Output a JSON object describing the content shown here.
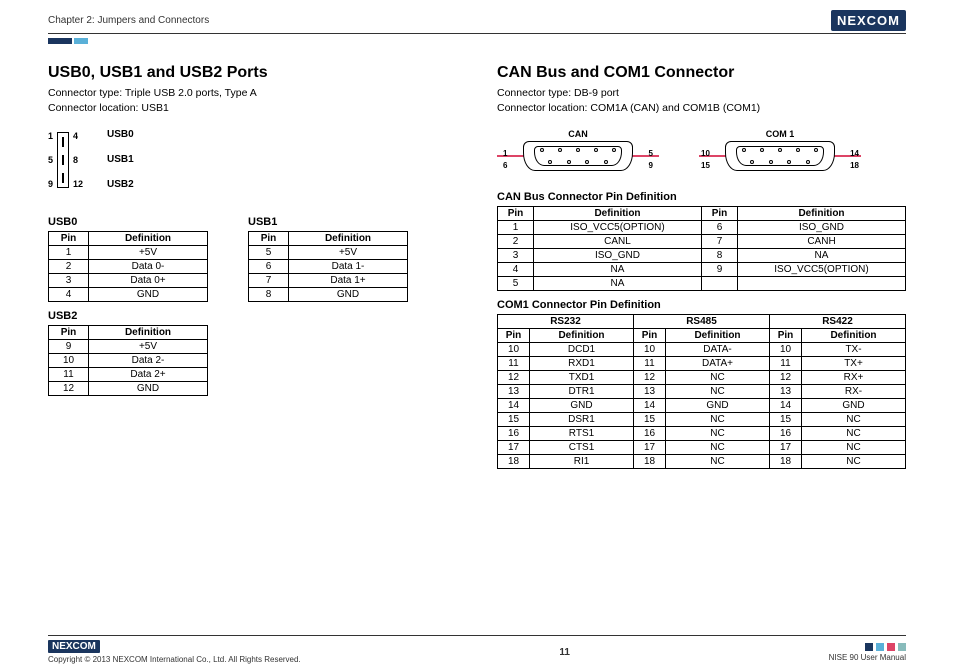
{
  "header": {
    "chapter": "Chapter 2: Jumpers and Connectors",
    "logo": "NEXCOM"
  },
  "left": {
    "title": "USB0, USB1 and USB2 Ports",
    "connector_type": "Connector type: Triple USB 2.0 ports, Type A",
    "connector_location": "Connector location: USB1",
    "diagram": {
      "rows": [
        {
          "pinL": "1",
          "pinR": "4",
          "label": "USB0"
        },
        {
          "pinL": "5",
          "pinR": "8",
          "label": "USB1"
        },
        {
          "pinL": "9",
          "pinR": "12",
          "label": "USB2"
        }
      ]
    },
    "tables": {
      "usb0": {
        "title": "USB0",
        "headers": [
          "Pin",
          "Definition"
        ],
        "rows": [
          [
            "1",
            "+5V"
          ],
          [
            "2",
            "Data 0-"
          ],
          [
            "3",
            "Data 0+"
          ],
          [
            "4",
            "GND"
          ]
        ]
      },
      "usb1": {
        "title": "USB1",
        "headers": [
          "Pin",
          "Definition"
        ],
        "rows": [
          [
            "5",
            "+5V"
          ],
          [
            "6",
            "Data 1-"
          ],
          [
            "7",
            "Data 1+"
          ],
          [
            "8",
            "GND"
          ]
        ]
      },
      "usb2": {
        "title": "USB2",
        "headers": [
          "Pin",
          "Definition"
        ],
        "rows": [
          [
            "9",
            "+5V"
          ],
          [
            "10",
            "Data 2-"
          ],
          [
            "11",
            "Data 2+"
          ],
          [
            "12",
            "GND"
          ]
        ]
      }
    }
  },
  "right": {
    "title": "CAN Bus and COM1 Connector",
    "connector_type": "Connector type: DB-9 port",
    "connector_location": "Connector location: COM1A (CAN) and COM1B (COM1)",
    "diagram": {
      "left": {
        "label": "CAN",
        "tl": "1",
        "bl": "6",
        "tr": "5",
        "br": "9"
      },
      "right": {
        "label": "COM 1",
        "tl": "10",
        "bl": "15",
        "tr": "14",
        "br": "18"
      }
    },
    "can_table": {
      "title": "CAN Bus Connector Pin Definition",
      "headers": [
        "Pin",
        "Definition",
        "Pin",
        "Definition"
      ],
      "rows": [
        [
          "1",
          "ISO_VCC5(OPTION)",
          "6",
          "ISO_GND"
        ],
        [
          "2",
          "CANL",
          "7",
          "CANH"
        ],
        [
          "3",
          "ISO_GND",
          "8",
          "NA"
        ],
        [
          "4",
          "NA",
          "9",
          "ISO_VCC5(OPTION)"
        ],
        [
          "5",
          "NA",
          "",
          ""
        ]
      ]
    },
    "com1_table": {
      "title": "COM1 Connector Pin Definition",
      "group_headers": [
        "RS232",
        "RS485",
        "RS422"
      ],
      "sub_headers": [
        "Pin",
        "Definition",
        "Pin",
        "Definition",
        "Pin",
        "Definition"
      ],
      "rows": [
        [
          "10",
          "DCD1",
          "10",
          "DATA-",
          "10",
          "TX-"
        ],
        [
          "11",
          "RXD1",
          "11",
          "DATA+",
          "11",
          "TX+"
        ],
        [
          "12",
          "TXD1",
          "12",
          "NC",
          "12",
          "RX+"
        ],
        [
          "13",
          "DTR1",
          "13",
          "NC",
          "13",
          "RX-"
        ],
        [
          "14",
          "GND",
          "14",
          "GND",
          "14",
          "GND"
        ],
        [
          "15",
          "DSR1",
          "15",
          "NC",
          "15",
          "NC"
        ],
        [
          "16",
          "RTS1",
          "16",
          "NC",
          "16",
          "NC"
        ],
        [
          "17",
          "CTS1",
          "17",
          "NC",
          "17",
          "NC"
        ],
        [
          "18",
          "RI1",
          "18",
          "NC",
          "18",
          "NC"
        ]
      ]
    }
  },
  "footer": {
    "copyright": "Copyright © 2013 NEXCOM International Co., Ltd. All Rights Reserved.",
    "page": "11",
    "manual": "NISE 90 User Manual",
    "logo": "NEXCOM"
  }
}
